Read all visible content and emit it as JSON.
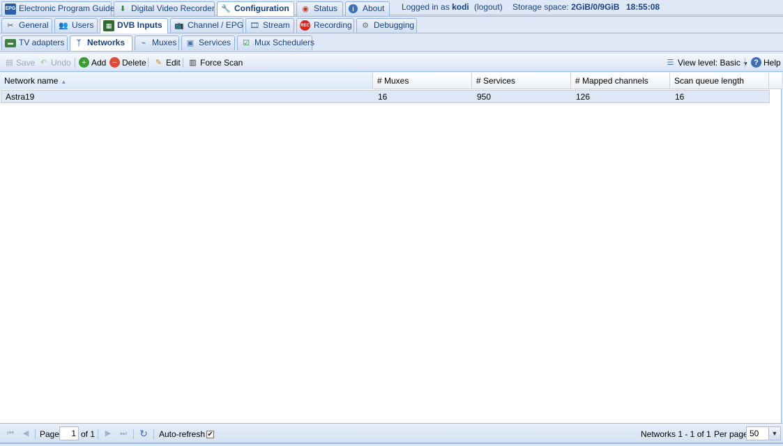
{
  "top_tabs": [
    {
      "label": "Electronic Program Guide",
      "icon": "epg-icon"
    },
    {
      "label": "Digital Video Recorder",
      "icon": "download-icon"
    },
    {
      "label": "Configuration",
      "icon": "wrench-icon",
      "active": true
    },
    {
      "label": "Status",
      "icon": "eye-icon"
    },
    {
      "label": "About",
      "icon": "info-icon"
    }
  ],
  "session": {
    "logged_in_prefix": "Logged in as",
    "user": "kodi",
    "logout": "(logout)",
    "storage_label": "Storage space:",
    "storage_value": "2GiB/0/9GiB",
    "time": "18:55:08"
  },
  "config_tabs": [
    {
      "label": "General",
      "icon": "tools-icon"
    },
    {
      "label": "Users",
      "icon": "users-icon"
    },
    {
      "label": "DVB Inputs",
      "icon": "chip-icon",
      "active": true
    },
    {
      "label": "Channel / EPG",
      "icon": "tv-icon"
    },
    {
      "label": "Stream",
      "icon": "film-icon"
    },
    {
      "label": "Recording",
      "icon": "rec-icon"
    },
    {
      "label": "Debugging",
      "icon": "gears-icon"
    }
  ],
  "dvb_tabs": [
    {
      "label": "TV adapters",
      "icon": "card-icon"
    },
    {
      "label": "Networks",
      "icon": "antenna-icon",
      "active": true
    },
    {
      "label": "Muxes",
      "icon": "mux-icon"
    },
    {
      "label": "Services",
      "icon": "tv-small-icon"
    },
    {
      "label": "Mux Schedulers",
      "icon": "calendar-check-icon"
    }
  ],
  "toolbar": {
    "save": "Save",
    "undo": "Undo",
    "add": "Add",
    "delete": "Delete",
    "edit": "Edit",
    "force_scan": "Force Scan",
    "view_level": "View level: Basic",
    "help": "Help"
  },
  "grid": {
    "columns": [
      "Network name",
      "# Muxes",
      "# Services",
      "# Mapped channels",
      "Scan queue length"
    ],
    "sorted_column": "Network name",
    "rows": [
      [
        "Astra19",
        "16",
        "950",
        "126",
        "16"
      ]
    ]
  },
  "pager": {
    "page_label": "Page",
    "page_value": "1",
    "of_label": "of 1",
    "auto_refresh": "Auto-refresh",
    "auto_refresh_checked": true,
    "summary": "Networks 1 - 1 of 1",
    "per_page_label": "Per page",
    "per_page_value": "50"
  },
  "colors": {
    "accent": "#15428b",
    "tab_border": "#8db2e3",
    "row_selected": "#dfe8f6",
    "rec_red": "#d8261d",
    "add_green": "#3a9c32",
    "delete_red": "#e04b3a"
  }
}
